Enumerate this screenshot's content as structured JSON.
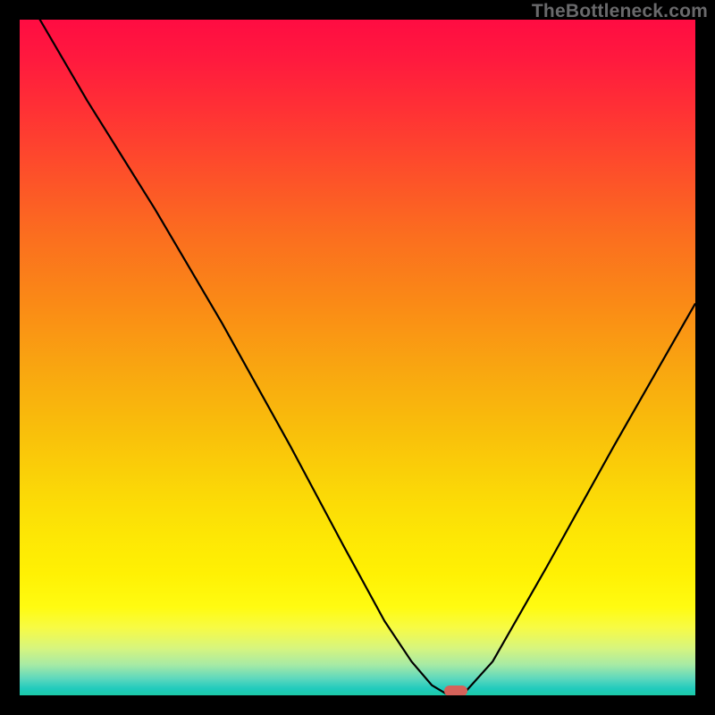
{
  "attribution": "TheBottleneck.com",
  "chart_data": {
    "type": "line",
    "title": "",
    "xlabel": "",
    "ylabel": "",
    "xlim": [
      0,
      100
    ],
    "ylim": [
      0,
      100
    ],
    "series": [
      {
        "name": "bottleneck-curve",
        "x": [
          0,
          3,
          10,
          20,
          30,
          40,
          48,
          54,
          58,
          61,
          63.5,
          65.5,
          70,
          78,
          88,
          100
        ],
        "y": [
          104,
          100,
          88,
          72,
          55,
          37,
          22,
          11,
          5,
          1.5,
          0,
          0,
          5,
          19,
          37,
          58
        ]
      }
    ],
    "marker": {
      "x": 64.5,
      "y": 0.7
    }
  },
  "colors": {
    "frame": "#000000",
    "curve": "#000000",
    "marker": "#d4625a",
    "gradient_top": "#ff0c42",
    "gradient_bottom": "#1bcaa7"
  }
}
